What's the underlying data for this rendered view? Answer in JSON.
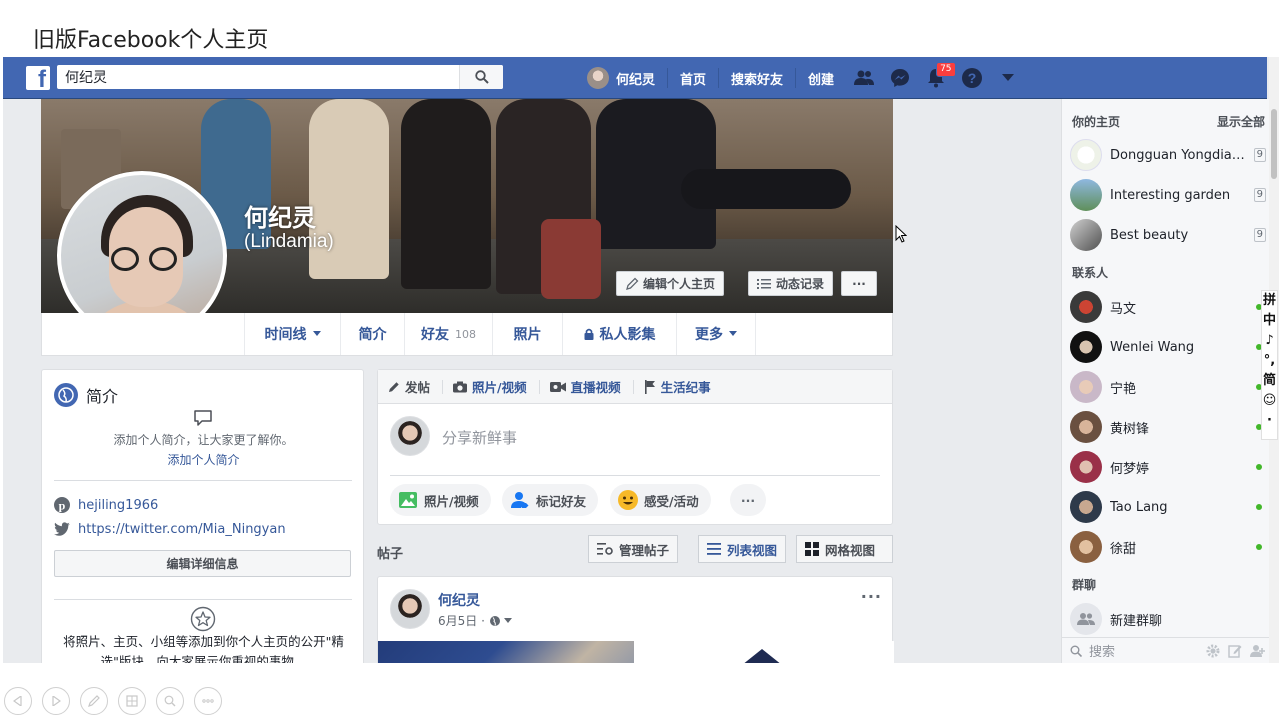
{
  "slide_title": "旧版Facebook个人主页",
  "topbar": {
    "search_value": "何纪灵",
    "user_name": "何纪灵",
    "links": [
      "首页",
      "搜索好友",
      "创建"
    ],
    "notification_count": "75",
    "brand_color": "#4267b2"
  },
  "profile": {
    "name": "何纪灵",
    "alt_name": "(Lindamia)",
    "edit_button": "编辑个人主页",
    "activity_button": "动态记录",
    "more_button": "···"
  },
  "tabs": {
    "timeline": "时间线",
    "about": "简介",
    "friends": "好友",
    "friends_count": "108",
    "photos": "照片",
    "archive": "私人影集",
    "more": "更多"
  },
  "intro": {
    "title": "简介",
    "hint": "添加个人简介，让大家更了解你。",
    "add_link": "添加个人简介",
    "pinterest": "hejiling1966",
    "twitter": "https://twitter.com/Mia_Ningyan",
    "edit_details": "编辑详细信息",
    "featured_text": "将照片、主页、小组等添加到你个人主页的公开\"精选\"版块，向大家展示你重视的事物。"
  },
  "composer": {
    "tabs": [
      "发帖",
      "照片/视频",
      "直播视频",
      "生活纪事"
    ],
    "placeholder": "分享新鲜事",
    "actions": [
      "照片/视频",
      "标记好友",
      "感受/活动",
      "···"
    ]
  },
  "posts": {
    "label": "帖子",
    "manage": "管理帖子",
    "list_view": "列表视图",
    "grid_view": "网格视图"
  },
  "post": {
    "author": "何纪灵",
    "date": "6月5日 ·",
    "more": "···"
  },
  "sidebar": {
    "pages_title": "你的主页",
    "show_all": "显示全部",
    "pages": [
      {
        "name": "Dongguan Yongdian...",
        "count": "9"
      },
      {
        "name": "Interesting garden",
        "count": "9"
      },
      {
        "name": "Best beauty",
        "count": "9"
      }
    ],
    "contacts_title": "联系人",
    "contacts": [
      "马文",
      "Wenlei Wang",
      "宁艳",
      "黄树锋",
      "何梦婷",
      "Tao Lang",
      "徐甜"
    ],
    "groups_title": "群聊",
    "new_group": "新建群聊",
    "search_placeholder": "搜索"
  },
  "ime": [
    "拼",
    "中",
    "♪",
    "°,",
    "简",
    "☺",
    "·"
  ]
}
